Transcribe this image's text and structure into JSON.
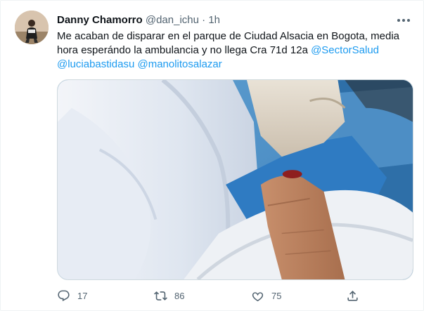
{
  "tweet": {
    "author_name": "Danny Chamorro",
    "handle": "@dan_ichu",
    "separator": "·",
    "time": "1h",
    "text_line1": "Me acaban de disparar en el parque de Ciudad Alsacia en Bogota, media",
    "text_line2_prefix": "hora esperándo la ambulancia y no llega Cra 71d 12a ",
    "mention1": "@SectorSalud",
    "mention2": "@luciabastidasu",
    "mention3": "@manolitosalazar",
    "space": " "
  },
  "actions": {
    "reply_count": "17",
    "retweet_count": "86",
    "like_count": "75"
  },
  "icons": {
    "more": "more-horizontal-icon",
    "reply": "reply-icon",
    "retweet": "retweet-icon",
    "like": "heart-icon",
    "share": "share-icon"
  },
  "colors": {
    "link": "#1d9bf0",
    "secondary_text": "#536471",
    "primary_text": "#0f1419"
  }
}
